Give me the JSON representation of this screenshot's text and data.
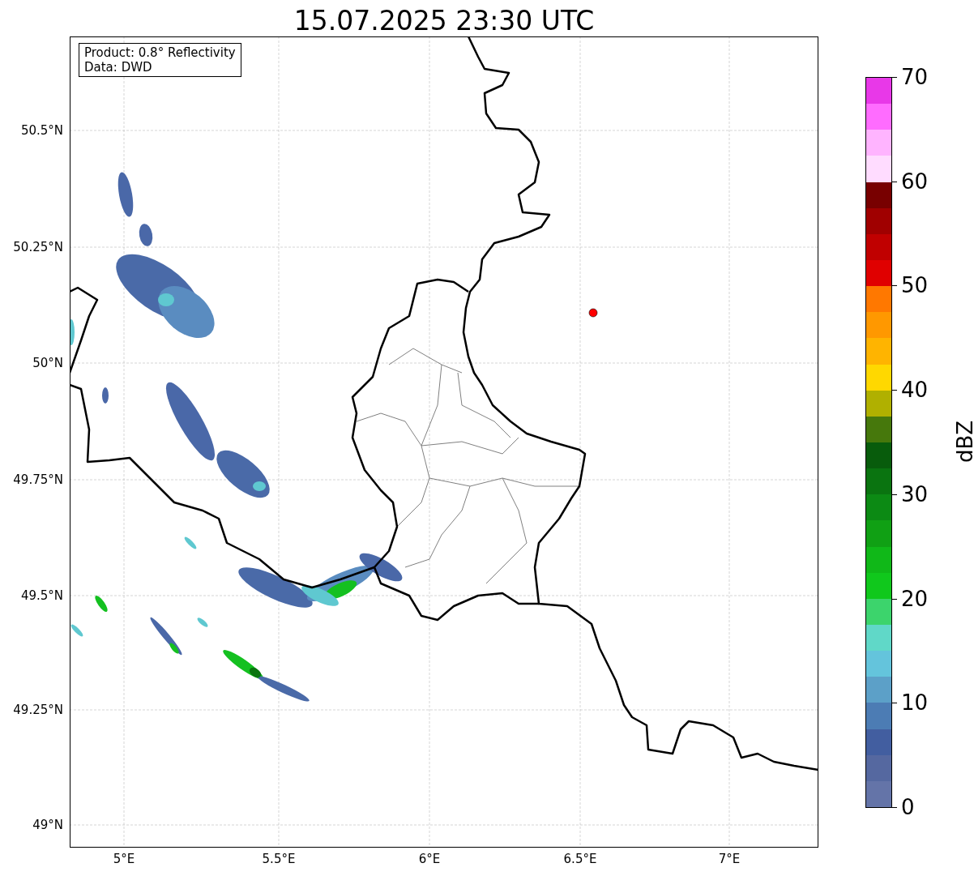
{
  "title": "15.07.2025 23:30 UTC",
  "info_box": [
    "Product: 0.8° Reflectivity",
    "Data: DWD"
  ],
  "lat_labels": [
    "50.5°N",
    "50.25°N",
    "50°N",
    "49.75°N",
    "49.5°N",
    "49.25°N",
    "49°N"
  ],
  "lon_labels": [
    "5°E",
    "5.5°E",
    "6°E",
    "6.5°E",
    "7°E"
  ],
  "colorbar": {
    "label": "dBZ",
    "ticks": [
      "70",
      "60",
      "50",
      "40",
      "30",
      "20",
      "10",
      "0"
    ],
    "bins": [
      {
        "color": "#6474a8"
      },
      {
        "color": "#5568a0"
      },
      {
        "color": "#425ea0"
      },
      {
        "color": "#4c7cb4"
      },
      {
        "color": "#5ca0c8"
      },
      {
        "color": "#64c4dc"
      },
      {
        "color": "#60d8c8"
      },
      {
        "color": "#3cd46c"
      },
      {
        "color": "#10c81c"
      },
      {
        "color": "#10b818"
      },
      {
        "color": "#10a014"
      },
      {
        "color": "#0c8a14"
      },
      {
        "color": "#0a7410"
      },
      {
        "color": "#085c0c"
      },
      {
        "color": "#46780c"
      },
      {
        "color": "#b0b000"
      },
      {
        "color": "#ffd800"
      },
      {
        "color": "#ffb400"
      },
      {
        "color": "#ff9800"
      },
      {
        "color": "#ff7800"
      },
      {
        "color": "#e00000"
      },
      {
        "color": "#c00000"
      },
      {
        "color": "#a00000"
      },
      {
        "color": "#780000"
      },
      {
        "color": "#ffdcff"
      },
      {
        "color": "#ffb4ff"
      },
      {
        "color": "#ff6cff"
      },
      {
        "color": "#e838e8"
      }
    ]
  }
}
